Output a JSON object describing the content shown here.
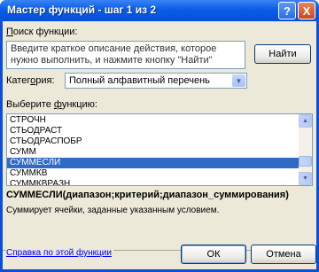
{
  "window": {
    "title": "Мастер функций - шаг 1 из 2",
    "help_icon": "?",
    "close_icon": "X"
  },
  "search": {
    "label_prefix": "П",
    "label_rest": "оиск функции:",
    "description": "Введите краткое описание действия, которое нужно выполнить, и нажмите кнопку \"Найти\"",
    "find_button": "Найти"
  },
  "category": {
    "label_prefix": "Катег",
    "label_u": "о",
    "label_rest": "рия:",
    "selected": "Полный алфавитный перечень"
  },
  "functions": {
    "label_prefix": "Выберите ",
    "label_u": "ф",
    "label_rest": "ункцию:",
    "items": [
      "СТРОЧН",
      "СТЬОДРАСТ",
      "СТЬОДРАСПОБР",
      "СУММ",
      "СУММЕСЛИ",
      "СУММКВ",
      "СУММКВРАЗН"
    ],
    "selected_index": 4
  },
  "details": {
    "signature": "СУММЕСЛИ(диапазон;критерий;диапазон_суммирования)",
    "description": "Суммирует ячейки, заданные указанным условием."
  },
  "footer": {
    "help_link": "Справка по этой функции",
    "ok_button": "ОК",
    "cancel_button": "Отмена"
  }
}
